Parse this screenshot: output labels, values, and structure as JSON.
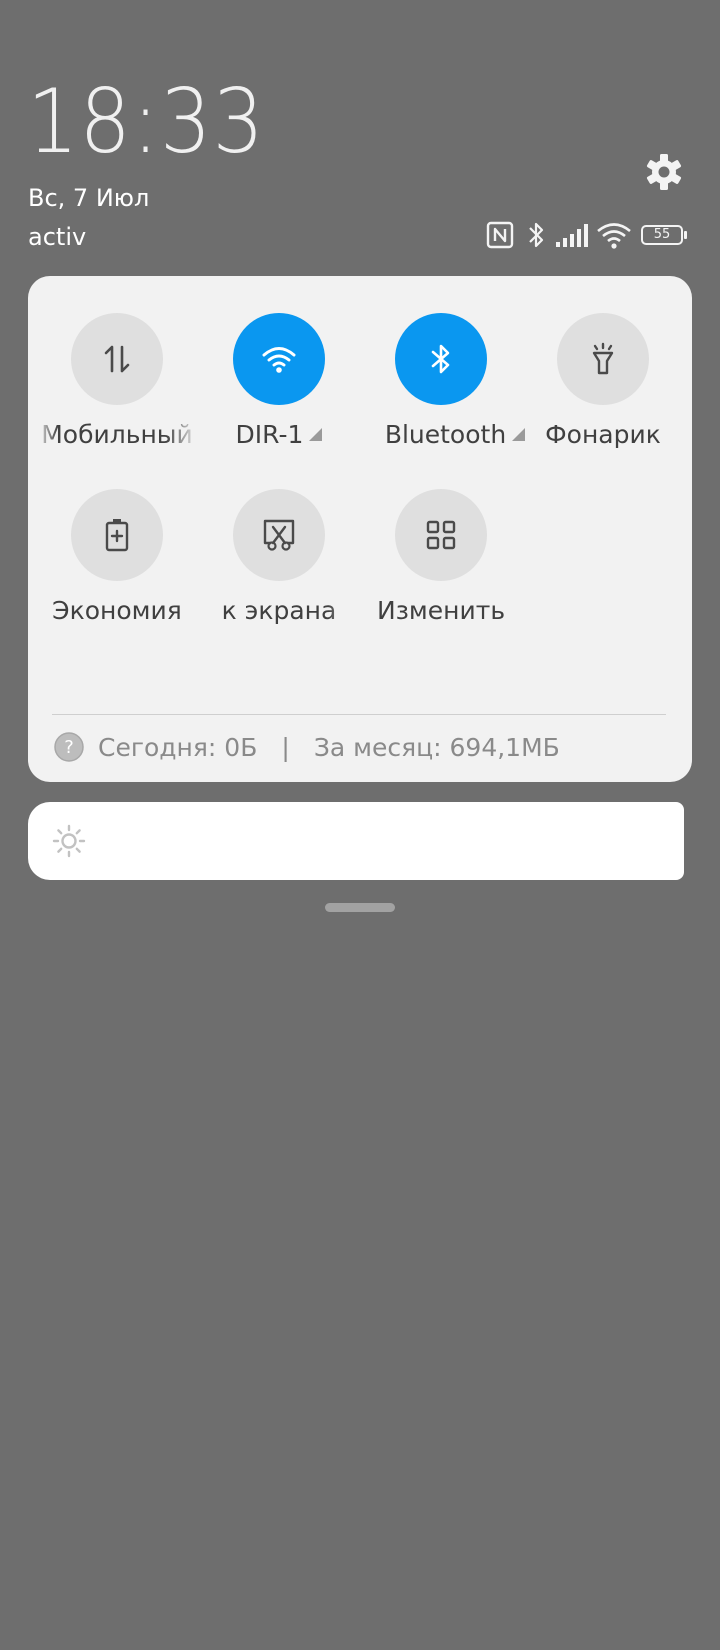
{
  "status": {
    "time": "18:33",
    "date": "Вс, 7 Июл",
    "carrier": "activ",
    "battery_level": "55"
  },
  "tiles": [
    {
      "label": "Мобильный",
      "icon": "data-transfer-icon",
      "active": false
    },
    {
      "label": "DIR-1",
      "icon": "wifi-icon",
      "active": true
    },
    {
      "label": "Bluetooth",
      "icon": "bluetooth-icon",
      "active": true
    },
    {
      "label": "Фонарик",
      "icon": "flashlight-icon",
      "active": false
    },
    {
      "label": "Экономия",
      "icon": "battery-saver-icon",
      "active": false
    },
    {
      "label": "к экрана",
      "icon": "screenshot-icon",
      "active": false
    },
    {
      "label": "Изменить",
      "icon": "edit-tiles-icon",
      "active": false
    }
  ],
  "data_usage": {
    "today": "Сегодня: 0Б",
    "separator": "|",
    "month": "За месяц: 694,1МБ"
  },
  "colors": {
    "background": "#6e6e6e",
    "panel": "#f2f2f2",
    "active_tile": "#0a97f0",
    "inactive_tile": "#dfdfdf"
  }
}
